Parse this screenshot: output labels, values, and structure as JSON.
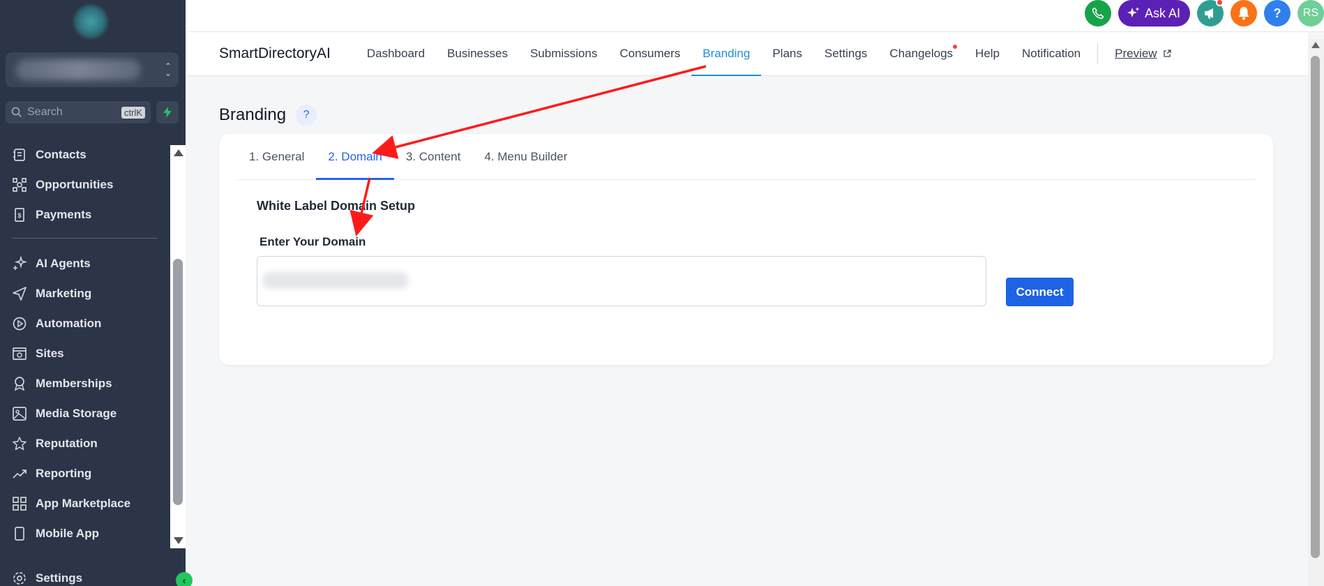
{
  "sidebar": {
    "search_placeholder": "Search",
    "search_shortcut": "ctrlK",
    "items": [
      {
        "label": "Contacts",
        "icon": "contacts-icon"
      },
      {
        "label": "Opportunities",
        "icon": "opportunities-icon"
      },
      {
        "label": "Payments",
        "icon": "payments-icon"
      },
      {
        "label": "AI Agents",
        "icon": "ai-agents-icon"
      },
      {
        "label": "Marketing",
        "icon": "marketing-icon"
      },
      {
        "label": "Automation",
        "icon": "automation-icon"
      },
      {
        "label": "Sites",
        "icon": "sites-icon"
      },
      {
        "label": "Memberships",
        "icon": "memberships-icon"
      },
      {
        "label": "Media Storage",
        "icon": "media-storage-icon"
      },
      {
        "label": "Reputation",
        "icon": "reputation-icon"
      },
      {
        "label": "Reporting",
        "icon": "reporting-icon"
      },
      {
        "label": "App Marketplace",
        "icon": "app-marketplace-icon"
      },
      {
        "label": "Mobile App",
        "icon": "mobile-app-icon"
      }
    ],
    "settings_label": "Settings"
  },
  "topbar": {
    "ask_ai_label": "Ask AI",
    "help_label": "?",
    "avatar_initials": "RS",
    "colors": {
      "phone": "#16a34a",
      "ask_ai": "#5b21b6",
      "announce": "#2f9e8f",
      "bell": "#f97316",
      "help": "#2f80ed",
      "avatar": "#6fcf97"
    }
  },
  "appnav": {
    "brand": "SmartDirectoryAI",
    "tabs": [
      "Dashboard",
      "Businesses",
      "Submissions",
      "Consumers",
      "Branding",
      "Plans",
      "Settings",
      "Changelogs",
      "Help",
      "Notification"
    ],
    "active_tab": "Branding",
    "preview_label": "Preview"
  },
  "page": {
    "title": "Branding",
    "help_label": "?",
    "tabs": [
      "1. General",
      "2. Domain",
      "3. Content",
      "4. Menu Builder"
    ],
    "active_tab": "2. Domain",
    "section_title": "White Label Domain Setup",
    "field_label": "Enter Your Domain",
    "domain_value": "",
    "connect_label": "Connect",
    "accent_color": "#2563eb"
  }
}
